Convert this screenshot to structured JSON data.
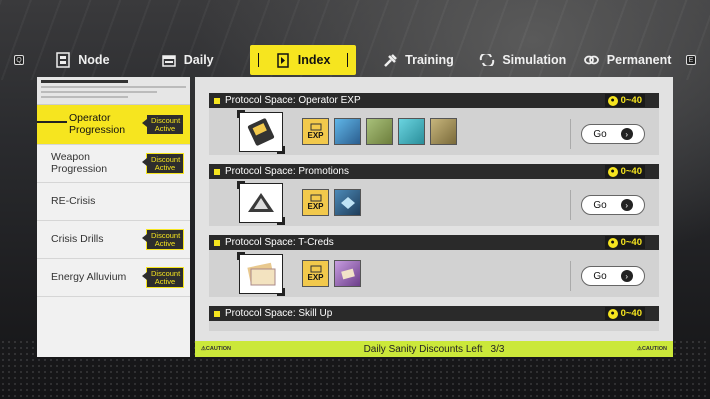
{
  "keys": {
    "left": "Q",
    "right": "E"
  },
  "tabs": [
    {
      "label": "Node",
      "icon": "node-icon"
    },
    {
      "label": "Daily",
      "icon": "calendar-icon"
    },
    {
      "label": "Index",
      "icon": "index-icon",
      "active": true
    },
    {
      "label": "Training",
      "icon": "training-icon"
    },
    {
      "label": "Simulation",
      "icon": "simulation-icon"
    },
    {
      "label": "Permanent",
      "icon": "permanent-icon"
    }
  ],
  "sidebar": {
    "items": [
      {
        "label": "Operator Progression",
        "badge": "Discount Active",
        "active": true
      },
      {
        "label": "Weapon Progression",
        "badge": "Discount Active"
      },
      {
        "label": "RE-Crisis",
        "badge": ""
      },
      {
        "label": "Crisis Drills",
        "badge": "Discount Active"
      },
      {
        "label": "Energy Alluvium",
        "badge": "Discount Active"
      }
    ]
  },
  "cards": [
    {
      "title": "Protocol Space: Operator EXP",
      "cost": "0~40",
      "go": "Go",
      "rewards": [
        "EXP",
        "",
        "",
        "",
        ""
      ]
    },
    {
      "title": "Protocol Space: Promotions",
      "cost": "0~40",
      "go": "Go",
      "rewards": [
        "EXP",
        ""
      ]
    },
    {
      "title": "Protocol Space: T-Creds",
      "cost": "0~40",
      "go": "Go",
      "rewards": [
        "EXP",
        ""
      ]
    },
    {
      "title": "Protocol Space: Skill Up",
      "cost": "0~40",
      "go": "Go",
      "rewards": []
    }
  ],
  "footer": {
    "caution_left": "⚠CAUTION",
    "caution_right": "⚠CAUTION",
    "text": "Daily Sanity Discounts Left",
    "count": "3/3"
  },
  "colors": {
    "accent": "#f6e51f",
    "footer": "#cbe83a",
    "dark": "#2a2a2a"
  }
}
